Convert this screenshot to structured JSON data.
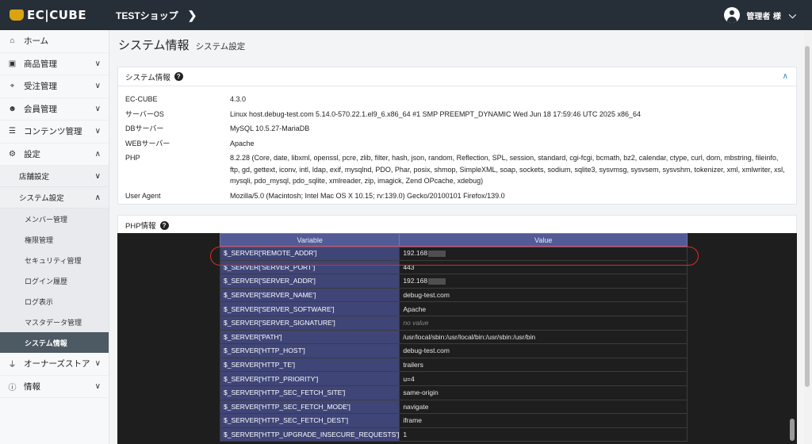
{
  "header": {
    "logo_text": "EC|CUBE",
    "shop_name": "TESTショップ",
    "user_label": "管理者 様"
  },
  "sidebar": {
    "items": [
      {
        "label": "ホーム",
        "icon": "home-icon"
      },
      {
        "label": "商品管理",
        "icon": "cube-icon"
      },
      {
        "label": "受注管理",
        "icon": "cart-icon"
      },
      {
        "label": "会員管理",
        "icon": "users-icon"
      },
      {
        "label": "コンテンツ管理",
        "icon": "file-icon"
      },
      {
        "label": "設定",
        "icon": "gear-icon"
      }
    ],
    "settings_sub": [
      {
        "label": "店舗設定"
      },
      {
        "label": "システム設定"
      }
    ],
    "system_sub": [
      {
        "label": "メンバー管理"
      },
      {
        "label": "権限管理"
      },
      {
        "label": "セキュリティ管理"
      },
      {
        "label": "ログイン履歴"
      },
      {
        "label": "ログ表示"
      },
      {
        "label": "マスタデータ管理"
      },
      {
        "label": "システム情報"
      }
    ],
    "bottom_items": [
      {
        "label": "オーナーズストア",
        "icon": "plug-icon"
      },
      {
        "label": "情報",
        "icon": "info-icon"
      }
    ]
  },
  "page": {
    "title": "システム情報",
    "subtitle": "システム設定"
  },
  "sysinfo": {
    "heading": "システム情報",
    "rows": [
      {
        "key": "EC-CUBE",
        "value": "4.3.0"
      },
      {
        "key": "サーバーOS",
        "value": "Linux host.debug-test.com 5.14.0-570.22.1.el9_6.x86_64 #1 SMP PREEMPT_DYNAMIC Wed Jun 18 17:59:46 UTC 2025 x86_64"
      },
      {
        "key": "DBサーバー",
        "value": "MySQL 10.5.27-MariaDB"
      },
      {
        "key": "WEBサーバー",
        "value": "Apache"
      },
      {
        "key": "PHP",
        "value": "8.2.28 (Core, date, libxml, openssl, pcre, zlib, filter, hash, json, random, Reflection, SPL, session, standard, cgi-fcgi, bcmath, bz2, calendar, ctype, curl, dom, mbstring, fileinfo, ftp, gd, gettext, iconv, intl, ldap, exif, mysqlnd, PDO, Phar, posix, shmop, SimpleXML, soap, sockets, sodium, sqlite3, sysvmsg, sysvsem, sysvshm, tokenizer, xml, xmlwriter, xsl, mysqli, pdo_mysql, pdo_sqlite, xmlreader, zip, imagick, Zend OPcache, xdebug)"
      },
      {
        "key": "User Agent",
        "value": "Mozilla/5.0 (Macintosh; Intel Mac OS X 10.15; rv:139.0) Gecko/20100101 Firefox/139.0"
      }
    ]
  },
  "phpinfo": {
    "heading": "PHP情報",
    "col_variable": "Variable",
    "col_value": "Value",
    "rows": [
      {
        "var": "$_SERVER['REMOTE_ADDR']",
        "val": "192.168",
        "masked": true
      },
      {
        "var": "$_SERVER['SERVER_PORT']",
        "val": "443"
      },
      {
        "var": "$_SERVER['SERVER_ADDR']",
        "val": "192.168",
        "masked": true
      },
      {
        "var": "$_SERVER['SERVER_NAME']",
        "val": "debug-test.com"
      },
      {
        "var": "$_SERVER['SERVER_SOFTWARE']",
        "val": "Apache"
      },
      {
        "var": "$_SERVER['SERVER_SIGNATURE']",
        "val": "no value",
        "novalue": true
      },
      {
        "var": "$_SERVER['PATH']",
        "val": "/usr/local/sbin:/usr/local/bin:/usr/sbin:/usr/bin"
      },
      {
        "var": "$_SERVER['HTTP_HOST']",
        "val": "debug-test.com"
      },
      {
        "var": "$_SERVER['HTTP_TE']",
        "val": "trailers"
      },
      {
        "var": "$_SERVER['HTTP_PRIORITY']",
        "val": "u=4"
      },
      {
        "var": "$_SERVER['HTTP_SEC_FETCH_SITE']",
        "val": "same-origin"
      },
      {
        "var": "$_SERVER['HTTP_SEC_FETCH_MODE']",
        "val": "navigate"
      },
      {
        "var": "$_SERVER['HTTP_SEC_FETCH_DEST']",
        "val": "iframe"
      },
      {
        "var": "$_SERVER['HTTP_UPGRADE_INSECURE_REQUESTS']",
        "val": "1"
      }
    ]
  },
  "colors": {
    "header_bg": "#262f38",
    "logo_accent": "#d9a312",
    "active_nav": "#4d5963",
    "table_header": "#525b96",
    "table_var": "#3f4577",
    "highlight": "#e02c22"
  }
}
